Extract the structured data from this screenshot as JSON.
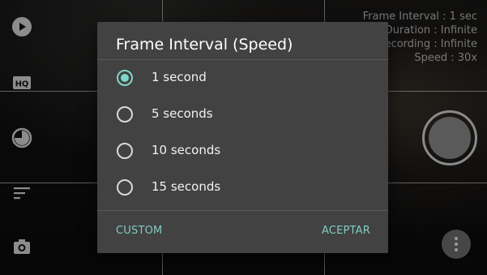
{
  "overlay": {
    "frame_interval": "Frame Interval : 1 sec",
    "video_duration": "Video Duration : Infinite",
    "recording": "Recording : Infinite",
    "speed": "Speed : 30x"
  },
  "left_toolbar": {
    "icons": [
      "play-icon",
      "hq-icon",
      "timer-icon",
      "menu-lines-icon",
      "camera-icon"
    ],
    "hq_label": "HQ"
  },
  "dialog": {
    "title": "Frame Interval (Speed)",
    "options": [
      {
        "label": "1 second",
        "selected": true
      },
      {
        "label": "5 seconds",
        "selected": false
      },
      {
        "label": "10 seconds",
        "selected": false
      },
      {
        "label": "15 seconds",
        "selected": false
      }
    ],
    "custom_label": "CUSTOM",
    "accept_label": "ACEPTAR"
  },
  "colors": {
    "accent": "#80CBC4",
    "dialog_bg": "#424242"
  }
}
